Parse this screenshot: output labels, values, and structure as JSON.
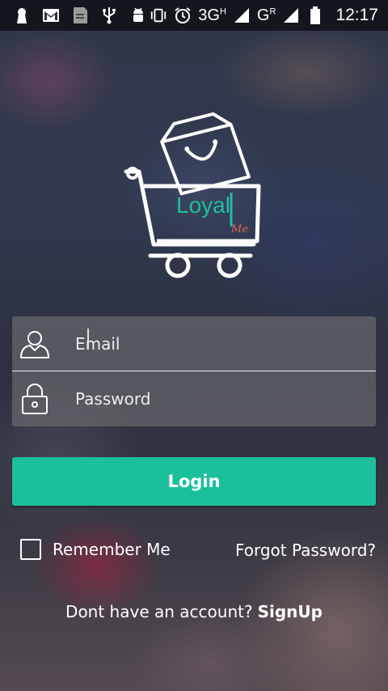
{
  "status_bar": {
    "icons_left": [
      "keyhole-icon",
      "gmail-icon",
      "sd-card-icon",
      "usb-icon",
      "android-debug-icon"
    ],
    "icons_right": [
      "vibrate-icon",
      "alarm-icon",
      "signal-icon",
      "signal-icon",
      "battery-icon"
    ],
    "network1": "3G",
    "network1_sup": "H",
    "network2": "G",
    "network2_sup": "R",
    "time": "12:17"
  },
  "logo": {
    "text": "Loyal",
    "sub": "Me"
  },
  "login_form": {
    "email_placeholder": "Email",
    "password_placeholder": "Password",
    "login_label": "Login",
    "remember_label": "Remember Me",
    "remember_checked": false,
    "forgot_label": "Forgot Password?",
    "no_account_text": "Dont have an account?",
    "signup_label": "SignUp"
  },
  "colors": {
    "accent": "#1cbf9c",
    "logo_sub": "#e2674c"
  }
}
